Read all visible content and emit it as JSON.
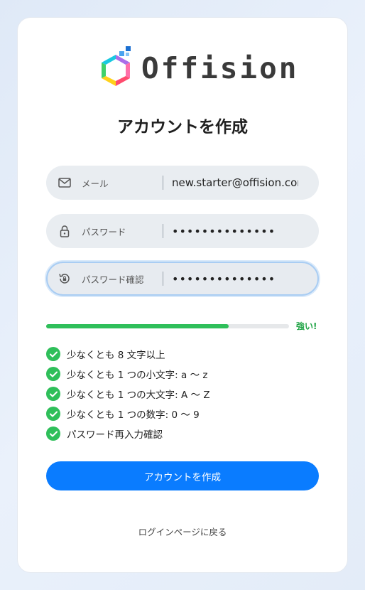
{
  "brand": {
    "name": "Offision"
  },
  "page": {
    "title": "アカウントを作成"
  },
  "fields": {
    "email": {
      "label": "メール",
      "value": "new.starter@offision.com",
      "icon": "mail-icon"
    },
    "password": {
      "label": "パスワード",
      "value": "••••••••••••••",
      "icon": "lock-icon"
    },
    "confirm": {
      "label": "パスワード確認",
      "value": "••••••••••••••",
      "icon": "history-lock-icon"
    }
  },
  "strength": {
    "label": "強い!",
    "level_percent": 75,
    "color": "#2fbf5a"
  },
  "requirements": [
    {
      "text": "少なくとも 8 文字以上",
      "met": true
    },
    {
      "text": "少なくとも 1 つの小文字: a 〜 z",
      "met": true
    },
    {
      "text": "少なくとも 1 つの大文字: A 〜 Z",
      "met": true
    },
    {
      "text": "少なくとも 1 つの数字: 0 〜 9",
      "met": true
    },
    {
      "text": "パスワード再入力確認",
      "met": true
    }
  ],
  "actions": {
    "submit_label": "アカウントを作成",
    "back_link": "ログインページに戻る"
  },
  "colors": {
    "accent": "#0a7cff",
    "success": "#2fbf5a",
    "focus_border": "#a9cdf3"
  }
}
